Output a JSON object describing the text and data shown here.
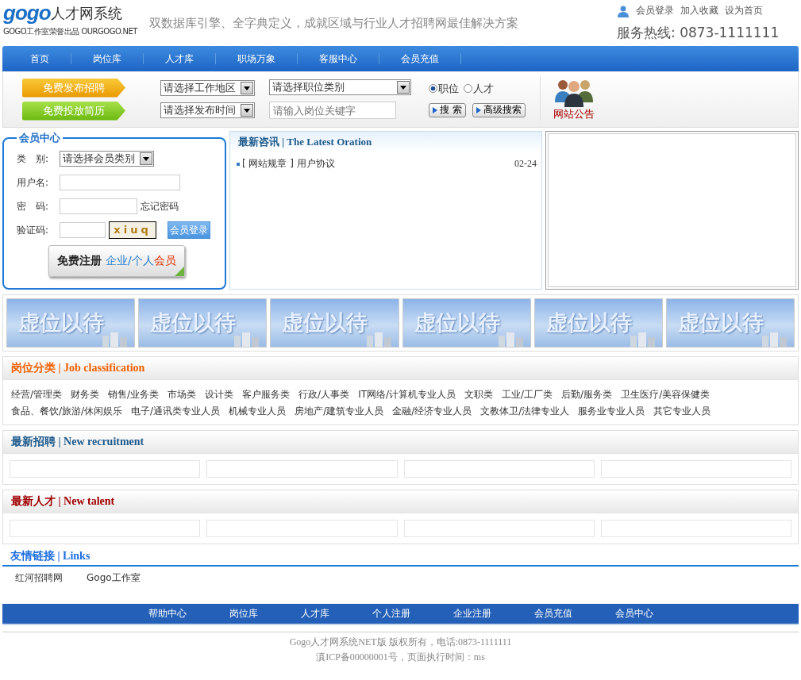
{
  "header": {
    "logo_mark": "gogo",
    "logo_text": "人才网系统",
    "logo_sub": "GOGO工作室荣誉出品 OURGOGO.NET",
    "slogan": "双数据库引擎、全字典定义，成就区域与行业人才招聘网最佳解决方案",
    "top_links": [
      "会员登录",
      "加入收藏",
      "设为首页"
    ],
    "hotline": "服务热线: 0873-1111111"
  },
  "nav": [
    "首页",
    "岗位库",
    "人才库",
    "职场万象",
    "客服中心",
    "会员充值"
  ],
  "search": {
    "post_job": "免费发布招聘",
    "post_resume": "免费投放简历",
    "area_select": "请选择工作地区",
    "time_select": "请选择发布时间",
    "category_select": "请选择职位类别",
    "keyword": {
      "placeholder": "请输入岗位关键字"
    },
    "modes": [
      {
        "label": "职位",
        "selected": true
      },
      {
        "label": "人才",
        "selected": false
      }
    ],
    "search_button": "搜 索",
    "advanced_button": "高级搜索",
    "notice": "网站公告"
  },
  "member": {
    "title": "会员中心",
    "type_label": "类　别:",
    "type_select": "请选择会员类别",
    "user_label": "用户名:",
    "pass_label": "密　码:",
    "forgot": "忘记密码",
    "code_label": "验证码:",
    "captcha": "xiuq",
    "login_button": "会员登录",
    "register": [
      "免费注册",
      "企业/个人",
      "会员"
    ]
  },
  "news": {
    "title": "最新咨讯 | The Latest Oration",
    "items": [
      {
        "text": "[ 网站规章 ] 用户协议",
        "date": "02-24"
      }
    ]
  },
  "banners": [
    "虚位以待",
    "虚位以待",
    "虚位以待",
    "虚位以待",
    "虚位以待",
    "虚位以待"
  ],
  "job_classification": {
    "title": "岗位分类 | Job classification",
    "items": [
      "经营/管理类",
      "财务类",
      "销售/业务类",
      "市场类",
      "设计类",
      "客户服务类",
      "行政/人事类",
      "IT网络/计算机专业人员",
      "文职类",
      "工业/工厂类",
      "后勤/服务类",
      "卫生医疗/美容保健类",
      "食品、餐饮/旅游/休闲娱乐",
      "电子/通讯类专业人员",
      "机械专业人员",
      "房地产/建筑专业人员",
      "金融/经济专业人员",
      "文教体卫/法律专业人",
      "服务业专业人员",
      "其它专业人员"
    ]
  },
  "new_recruitment": {
    "title": "最新招聘 | New recruitment"
  },
  "new_talent": {
    "title": "最新人才 | New talent"
  },
  "links": {
    "title": "友情链接 | Links",
    "items": [
      "红河招聘网",
      "Gogo工作室"
    ]
  },
  "footer_nav": [
    "帮助中心",
    "岗位库",
    "人才库",
    "个人注册",
    "企业注册",
    "会员充值",
    "会员中心"
  ],
  "copyright": [
    "Gogo人才网系统NET版 版权所有，电话:0873-1111111",
    "滇ICP备00000001号，页面执行时间：ms"
  ]
}
